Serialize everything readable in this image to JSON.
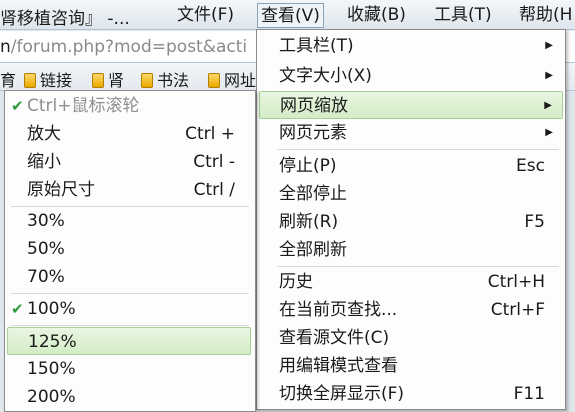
{
  "window": {
    "title": "肾移植咨询』 -..."
  },
  "menubar": {
    "file": "文件(F)",
    "view": "查看(V)",
    "favorites": "收藏(B)",
    "tools": "工具(T)",
    "help": "帮助(H"
  },
  "address": {
    "host": "n",
    "path": "/forum.php?mod=post&acti"
  },
  "favorites_bar": {
    "items": [
      {
        "label": "育"
      },
      {
        "label": "链接"
      },
      {
        "label": "肾"
      },
      {
        "label": "书法"
      },
      {
        "label": "网址"
      }
    ]
  },
  "view_menu": {
    "items": [
      {
        "label": "工具栏(T)",
        "shortcut": "",
        "submenu": true,
        "highlighted": false
      },
      {
        "label": "文字大小(X)",
        "shortcut": "",
        "submenu": true,
        "highlighted": false
      },
      {
        "label": "网页缩放",
        "shortcut": "",
        "submenu": true,
        "highlighted": true
      },
      {
        "label": "网页元素",
        "shortcut": "",
        "submenu": true,
        "highlighted": false
      },
      {
        "label": "停止(P)",
        "shortcut": "Esc",
        "submenu": false,
        "highlighted": false
      },
      {
        "label": "全部停止",
        "shortcut": "",
        "submenu": false,
        "highlighted": false
      },
      {
        "label": "刷新(R)",
        "shortcut": "F5",
        "submenu": false,
        "highlighted": false
      },
      {
        "label": "全部刷新",
        "shortcut": "",
        "submenu": false,
        "highlighted": false
      },
      {
        "label": "历史",
        "shortcut": "Ctrl+H",
        "submenu": false,
        "highlighted": false
      },
      {
        "label": "在当前页查找...",
        "shortcut": "Ctrl+F",
        "submenu": false,
        "highlighted": false
      },
      {
        "label": "查看源文件(C)",
        "shortcut": "",
        "submenu": false,
        "highlighted": false
      },
      {
        "label": "用编辑模式查看",
        "shortcut": "",
        "submenu": false,
        "highlighted": false
      },
      {
        "label": "切换全屏显示(F)",
        "shortcut": "F11",
        "submenu": false,
        "highlighted": false
      }
    ]
  },
  "zoom_menu": {
    "items": [
      {
        "label": "Ctrl+鼠标滚轮",
        "shortcut": "",
        "checked": true,
        "disabled": true,
        "highlighted": false
      },
      {
        "label": "放大",
        "shortcut": "Ctrl +",
        "checked": false,
        "disabled": false,
        "highlighted": false
      },
      {
        "label": "缩小",
        "shortcut": "Ctrl -",
        "checked": false,
        "disabled": false,
        "highlighted": false
      },
      {
        "label": "原始尺寸",
        "shortcut": "Ctrl /",
        "checked": false,
        "disabled": false,
        "highlighted": false
      },
      {
        "label": "30%",
        "shortcut": "",
        "checked": false,
        "disabled": false,
        "highlighted": false
      },
      {
        "label": "50%",
        "shortcut": "",
        "checked": false,
        "disabled": false,
        "highlighted": false
      },
      {
        "label": "70%",
        "shortcut": "",
        "checked": false,
        "disabled": false,
        "highlighted": false
      },
      {
        "label": "100%",
        "shortcut": "",
        "checked": true,
        "disabled": false,
        "highlighted": false
      },
      {
        "label": "125%",
        "shortcut": "",
        "checked": false,
        "disabled": false,
        "highlighted": true
      },
      {
        "label": "150%",
        "shortcut": "",
        "checked": false,
        "disabled": false,
        "highlighted": false
      },
      {
        "label": "200%",
        "shortcut": "",
        "checked": false,
        "disabled": false,
        "highlighted": false
      }
    ]
  },
  "icons": {
    "submenu_arrow": "triangle-right-icon",
    "check": "check-icon",
    "favorite": "folder-icon"
  },
  "colors": {
    "highlight_bg": "#d8eecb",
    "highlight_border": "#a9d196",
    "check": "#2c9a3b",
    "disabled_text": "#8f8f8f"
  }
}
